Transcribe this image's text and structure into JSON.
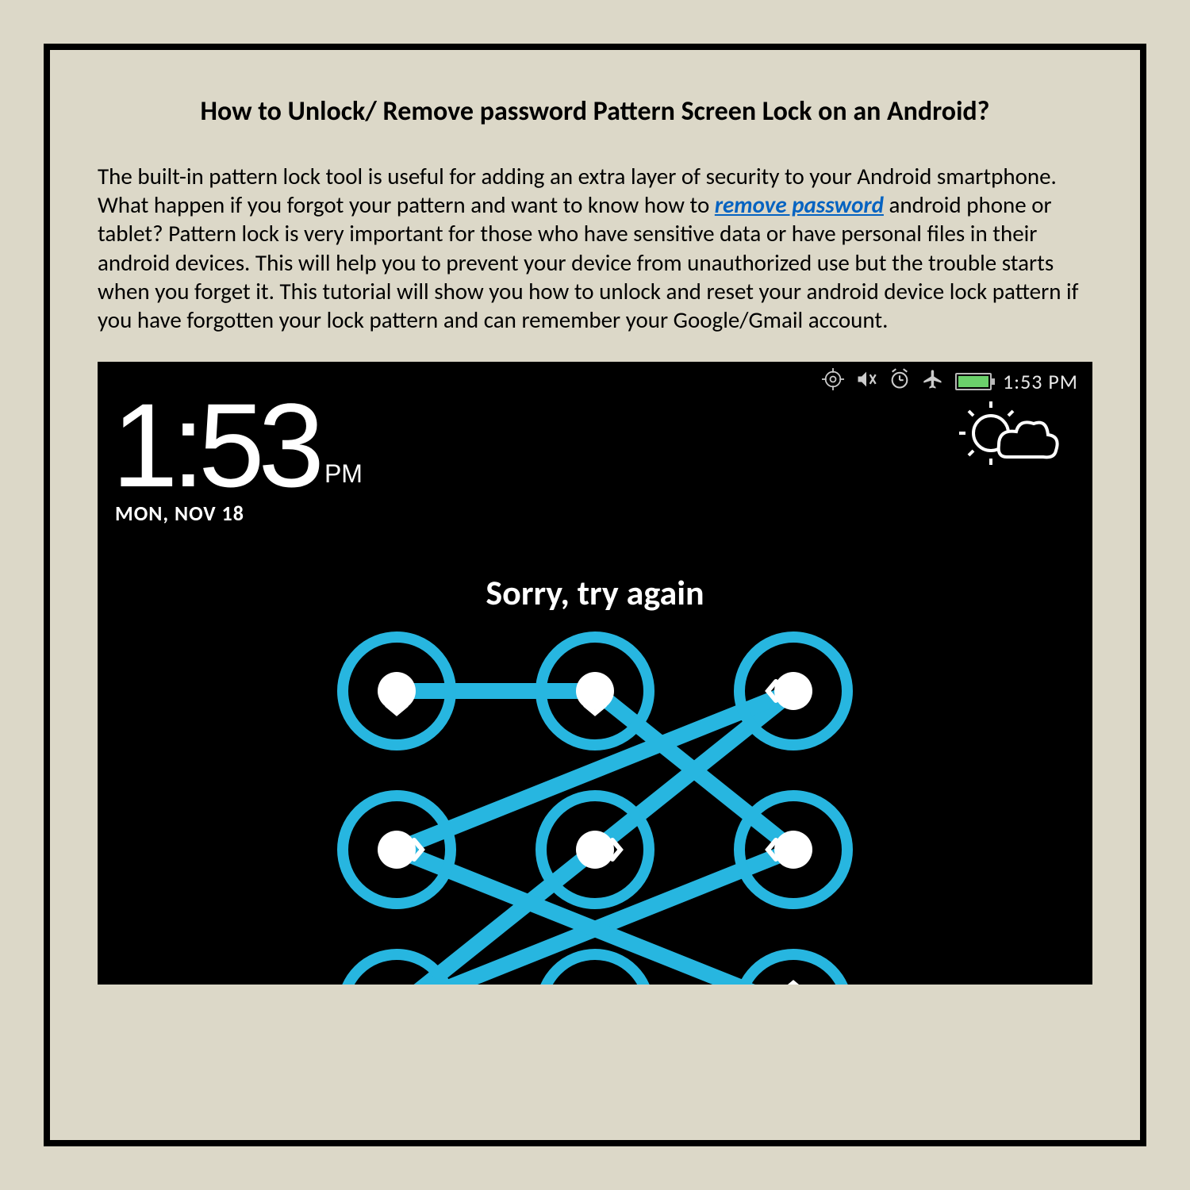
{
  "title": "How to Unlock/ Remove password Pattern Screen Lock on an Android?",
  "body": {
    "part1": "The built-in pattern lock tool is useful for adding an extra layer of security to your Android smartphone. What happen if you forgot your pattern and want to know how to ",
    "link_text": "remove password",
    "part2": " android phone or tablet? Pattern lock is very important for those who have sensitive data or have personal files in their android devices. This will help you to prevent your device from unauthorized use but the trouble starts when you forget it. This tutorial will show you how to unlock and reset your android device lock pattern if you have forgotten your lock pattern and can remember your Google/Gmail account."
  },
  "phone": {
    "status_time": "1:53 PM",
    "big_time": "1:53",
    "big_time_ampm": "PM",
    "date": "MON, NOV 18",
    "message": "Sorry, try again",
    "colors": {
      "pattern_line": "#27b6e0",
      "dot_outer": "#27b6e0",
      "dot_inner": "#ffffff"
    }
  }
}
